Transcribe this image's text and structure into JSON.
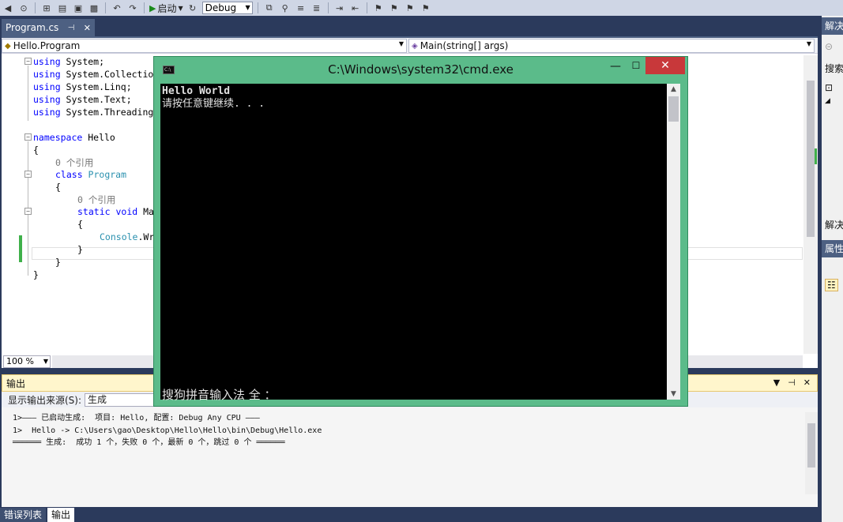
{
  "toolbar": {
    "start_label": "启动",
    "config_value": "Debug"
  },
  "editor": {
    "tab_label": "Program.cs",
    "nav_left": "Hello.Program",
    "nav_right": "Main(string[] args)",
    "zoom": "100 %",
    "lines": {
      "l1_kw": "using",
      "l1_rest": " System;",
      "l2_kw": "using",
      "l2_rest": " System.Collectio",
      "l3_kw": "using",
      "l3_rest": " System.Linq;",
      "l4_kw": "using",
      "l4_rest": " System.Text;",
      "l5_kw": "using",
      "l5_rest": " System.Threading",
      "l6_kw": "namespace",
      "l6_rest": " Hello",
      "l7": "{",
      "ref1": "0 个引用",
      "l8_kw": "class",
      "l8_ty": " Program",
      "l9": "{",
      "ref2": "0 个引用",
      "l10_kw1": "static",
      "l10_kw2": " void",
      "l10_rest": " Ma",
      "l11": "{",
      "l12_ty": "Console",
      "l12_rest": ".Wr",
      "l13": "}",
      "l14": "}",
      "l15": "}"
    }
  },
  "output": {
    "title": "输出",
    "source_label": "显示输出来源(S):",
    "source_value": "生成",
    "line1": "1>——— 已启动生成:  项目: Hello, 配置: Debug Any CPU ———",
    "line2": "1>  Hello -> C:\\Users\\gao\\Desktop\\Hello\\Hello\\bin\\Debug\\Hello.exe",
    "line3": "══════ 生成:  成功 1 个，失败 0 个，最新 0 个，跳过 0 个 ══════"
  },
  "bottom_tabs": {
    "errors": "错误列表",
    "output": "输出"
  },
  "right_panel": {
    "solution_title": "解决",
    "search_text": "搜索",
    "solution_short": "解决",
    "props_title": "属性"
  },
  "cmd": {
    "title": "C:\\Windows\\system32\\cmd.exe",
    "line1": "Hello World",
    "line2": "请按任意键继续. . .",
    "ime": "搜狗拼音输入法 全 ："
  }
}
